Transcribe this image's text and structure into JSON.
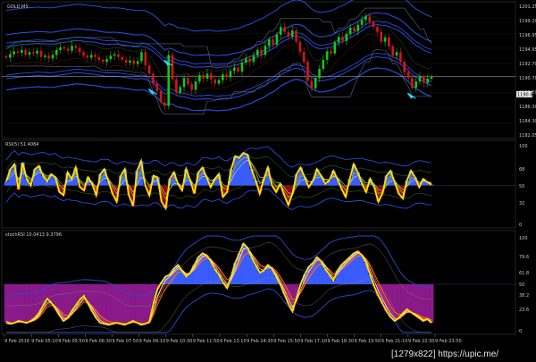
{
  "window": {
    "symbol_title": "GOLD,M5"
  },
  "price_axis": {
    "ticks": [
      "1201.25",
      "1199.20",
      "1196.95",
      "1194.95",
      "1192.70",
      "1190.70",
      "1188.50",
      "1186.30",
      "1184.30",
      "1182.05"
    ],
    "current_price": "1190.80"
  },
  "rsi": {
    "title": "RSI(5) 51.4084",
    "levels": [
      "100",
      "68",
      "50",
      "32",
      "0"
    ]
  },
  "stoch": {
    "title": "stochRSI 10.0413 9.3796",
    "levels": [
      "100",
      "79.6",
      "61.8",
      "50",
      "38.2",
      "23.6",
      "0"
    ]
  },
  "time_axis": {
    "ticks": [
      "9 Feb 2016",
      "9 Feb 05:10",
      "9 Feb 05:50",
      "9 Feb 06:30",
      "9 Feb 07:50",
      "9 Feb 09:10",
      "9 Feb 10:30",
      "9 Feb 11:50",
      "9 Feb 13:10",
      "9 Feb 14:30",
      "9 Feb 15:50",
      "9 Feb 17:10",
      "9 Feb 18:30",
      "9 Feb 19:50",
      "9 Feb 21:10",
      "9 Feb 22:30",
      "9 Feb 23:50"
    ]
  },
  "watermark": "[1279x822] https://upic.me/",
  "colors": {
    "background": "#000000",
    "bull": "#16c816",
    "bear": "#d01818",
    "bands": "#2a4ad8",
    "rsi_pos": "#3a5cff",
    "rsi_neg": "#8b0d0d",
    "stoch_pos": "#3a5cff",
    "stoch_neg": "#8a1a8a",
    "main_line": "#ffe000",
    "arrow": "#2ad4ff"
  },
  "chart_data": [
    {
      "type": "candlestick",
      "title": "GOLD,M5",
      "ylim": [
        1182.05,
        1201.25
      ],
      "close": [
        1193.5,
        1194.0,
        1194.4,
        1194.2,
        1194.6,
        1193.9,
        1194.3,
        1194.1,
        1194.5,
        1193.6,
        1193.8,
        1193.4,
        1193.9,
        1194.6,
        1195.0,
        1194.8,
        1194.5,
        1195.2,
        1194.9,
        1194.3,
        1193.8,
        1193.5,
        1193.9,
        1193.6,
        1193.2,
        1192.9,
        1193.3,
        1193.8,
        1194.0,
        1193.6,
        1193.2,
        1192.8,
        1193.1,
        1192.6,
        1193.0,
        1194.3,
        1192.4,
        1191.2,
        1189.8,
        1188.7,
        1187.1,
        1186.6,
        1193.9,
        1190.4,
        1188.5,
        1189.3,
        1190.6,
        1189.7,
        1188.9,
        1190.1,
        1191.0,
        1190.5,
        1191.2,
        1190.4,
        1189.8,
        1190.3,
        1191.1,
        1190.7,
        1191.6,
        1192.1,
        1191.5,
        1192.8,
        1193.4,
        1192.9,
        1193.8,
        1194.6,
        1193.9,
        1195.2,
        1196.1,
        1195.4,
        1196.8,
        1197.9,
        1197.2,
        1196.5,
        1197.4,
        1195.8,
        1194.3,
        1192.9,
        1190.2,
        1189.1,
        1190.6,
        1191.9,
        1193.2,
        1194.4,
        1194.1,
        1195.7,
        1196.5,
        1195.9,
        1196.9,
        1197.8,
        1197.3,
        1198.2,
        1198.9,
        1199.4,
        1198.6,
        1197.9,
        1197.2,
        1195.8,
        1196.4,
        1195.1,
        1193.8,
        1194.3,
        1192.9,
        1191.4,
        1190.6,
        1189.2,
        1190.1,
        1190.8,
        1189.9,
        1190.5,
        1190.8
      ],
      "arrows": [
        {
          "index": 38,
          "dir": "down"
        },
        {
          "index": 42,
          "dir": "down"
        },
        {
          "index": 105,
          "dir": "down"
        }
      ]
    },
    {
      "type": "area",
      "title": "RSI(5) 51.4084",
      "ylim": [
        0,
        100
      ],
      "values": [
        55,
        70,
        76,
        45,
        78,
        58,
        50,
        70,
        74,
        62,
        55,
        64,
        60,
        42,
        38,
        66,
        58,
        72,
        48,
        44,
        60,
        52,
        38,
        64,
        70,
        55,
        40,
        30,
        62,
        70,
        38,
        25,
        68,
        80,
        50,
        38,
        62,
        60,
        30,
        22,
        58,
        66,
        52,
        44,
        70,
        56,
        40,
        66,
        72,
        60,
        48,
        58,
        64,
        36,
        42,
        70,
        86,
        84,
        90,
        88,
        70,
        56,
        40,
        58,
        72,
        50,
        42,
        52,
        38,
        26,
        40,
        64,
        72,
        60,
        48,
        56,
        70,
        62,
        52,
        56,
        68,
        58,
        46,
        36,
        58,
        76,
        66,
        52,
        42,
        58,
        48,
        30,
        40,
        62,
        68,
        54,
        40,
        34,
        56,
        68,
        60,
        48,
        58,
        54,
        51
      ],
      "series": [
        {
          "values": [
            58,
            64,
            68,
            56,
            70,
            62,
            55,
            65,
            70,
            64,
            58,
            62,
            61,
            50,
            46,
            58,
            58,
            66,
            54,
            50,
            58,
            55,
            46,
            58,
            64,
            58,
            48,
            40,
            56,
            64,
            48,
            38,
            58,
            70,
            58,
            48,
            58,
            59,
            42,
            34,
            52,
            60,
            54,
            48,
            62,
            58,
            48,
            60,
            66,
            60,
            52,
            56,
            60,
            46,
            46,
            62,
            76,
            80,
            84,
            84,
            76,
            66,
            52,
            56,
            64,
            56,
            48,
            50,
            44,
            36,
            40,
            54,
            64,
            62,
            54,
            56,
            64,
            62,
            56,
            56,
            62,
            58,
            50,
            44,
            52,
            66,
            64,
            56,
            48,
            54,
            50,
            40,
            42,
            54,
            62,
            56,
            46,
            40,
            50,
            60,
            58,
            52,
            56,
            55,
            53
          ]
        }
      ]
    },
    {
      "type": "area",
      "title": "stochRSI 10.0413 9.3796",
      "ylim": [
        0,
        100
      ],
      "values": [
        10,
        9,
        10,
        12,
        11,
        10,
        12,
        15,
        20,
        28,
        35,
        31,
        25,
        18,
        12,
        15,
        22,
        28,
        34,
        38,
        30,
        22,
        15,
        10,
        9,
        8,
        9,
        10,
        9,
        8,
        10,
        12,
        10,
        8,
        9,
        11,
        30,
        45,
        52,
        58,
        60,
        66,
        70,
        64,
        58,
        62,
        70,
        78,
        82,
        80,
        74,
        66,
        60,
        52,
        46,
        58,
        72,
        82,
        92,
        88,
        78,
        70,
        62,
        64,
        70,
        66,
        58,
        50,
        40,
        30,
        22,
        36,
        50,
        60,
        68,
        72,
        78,
        74,
        66,
        60,
        54,
        64,
        70,
        74,
        78,
        82,
        84,
        80,
        72,
        60,
        48,
        38,
        30,
        22,
        16,
        12,
        15,
        20,
        24,
        21,
        18,
        15,
        12,
        14,
        10
      ],
      "series": [
        {
          "values": [
            12,
            10,
            10,
            11,
            11,
            10,
            11,
            13,
            17,
            24,
            30,
            31,
            27,
            21,
            15,
            14,
            18,
            24,
            30,
            35,
            32,
            26,
            19,
            13,
            10,
            9,
            9,
            10,
            9,
            9,
            9,
            11,
            10,
            9,
            9,
            10,
            22,
            36,
            46,
            54,
            58,
            62,
            66,
            64,
            60,
            61,
            66,
            73,
            78,
            79,
            76,
            70,
            63,
            56,
            50,
            54,
            64,
            75,
            86,
            88,
            82,
            74,
            66,
            64,
            67,
            66,
            60,
            53,
            44,
            35,
            27,
            32,
            44,
            54,
            63,
            69,
            75,
            75,
            70,
            63,
            57,
            60,
            66,
            71,
            75,
            79,
            82,
            81,
            75,
            65,
            54,
            44,
            35,
            27,
            20,
            15,
            14,
            17,
            21,
            21,
            19,
            16,
            13,
            13,
            11
          ]
        }
      ]
    }
  ]
}
